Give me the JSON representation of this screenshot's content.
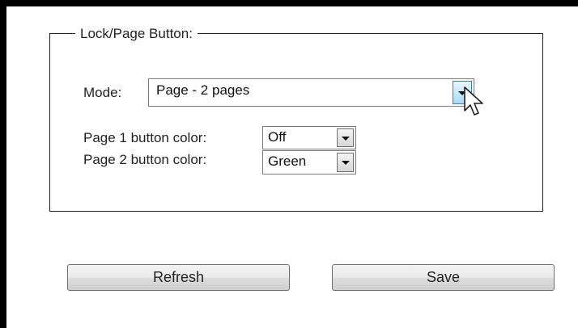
{
  "group": {
    "legend": "Lock/Page Button:"
  },
  "mode": {
    "label": "Mode:",
    "value": "Page - 2 pages"
  },
  "page1": {
    "label": "Page 1 button color:",
    "value": "Off"
  },
  "page2": {
    "label": "Page 2 button color:",
    "value": "Green"
  },
  "buttons": {
    "refresh": "Refresh",
    "save": "Save"
  },
  "icons": {
    "dropdown": "chevron-down-icon",
    "cursor": "mouse-pointer-icon"
  },
  "colors": {
    "frame": "#000000",
    "background": "#ffffff",
    "active_dropdown": "#a9dbf6"
  }
}
